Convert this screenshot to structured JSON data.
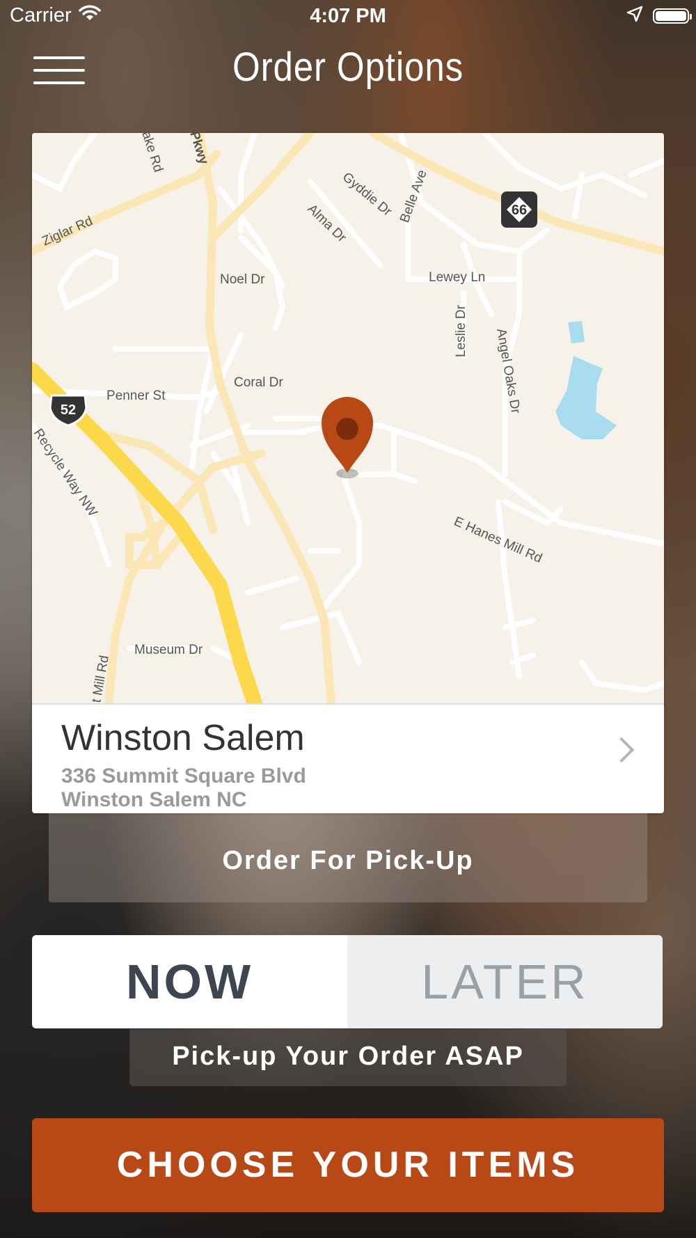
{
  "status_bar": {
    "carrier": "Carrier",
    "time": "4:07 PM",
    "icons": [
      "wifi-icon",
      "location-arrow-icon",
      "battery-icon"
    ]
  },
  "nav": {
    "title": "Order Options",
    "menu_icon": "hamburger-menu-icon"
  },
  "map": {
    "pin_icon": "map-pin-icon",
    "pin_color": "#b84916",
    "road_labels": {
      "ziglar": "Ziglar Rd",
      "lake": "ake Rd",
      "pkwy": "Pkwy",
      "gyddie": "Gyddie Dr",
      "belle": "Belle Ave",
      "alma": "Alma Dr",
      "noel": "Noel Dr",
      "lewey": "Lewey Ln",
      "leslie": "Leslie Dr",
      "angel": "Angel Oaks Dr",
      "coral": "Coral Dr",
      "penner": "Penner St",
      "recycle": "Recycle Way NW",
      "hanes": "E Hanes Mill Rd",
      "museum": "Museum Dr",
      "mill": "t Mill Rd"
    },
    "shields": {
      "us52": "52",
      "nc66": "66"
    }
  },
  "location": {
    "name": "Winston Salem",
    "address_line1": "336 Summit Square Blvd",
    "address_line2": "Winston Salem NC"
  },
  "order_type": "Order For Pick-Up",
  "timing": {
    "selected": "NOW",
    "options": [
      "NOW",
      "LATER"
    ]
  },
  "timing_note": "Pick-up Your Order ASAP",
  "cta": "CHOOSE YOUR ITEMS",
  "colors": {
    "accent": "#b84916",
    "selected_text": "#3d4650",
    "unselected_text": "#9aa0a6"
  }
}
